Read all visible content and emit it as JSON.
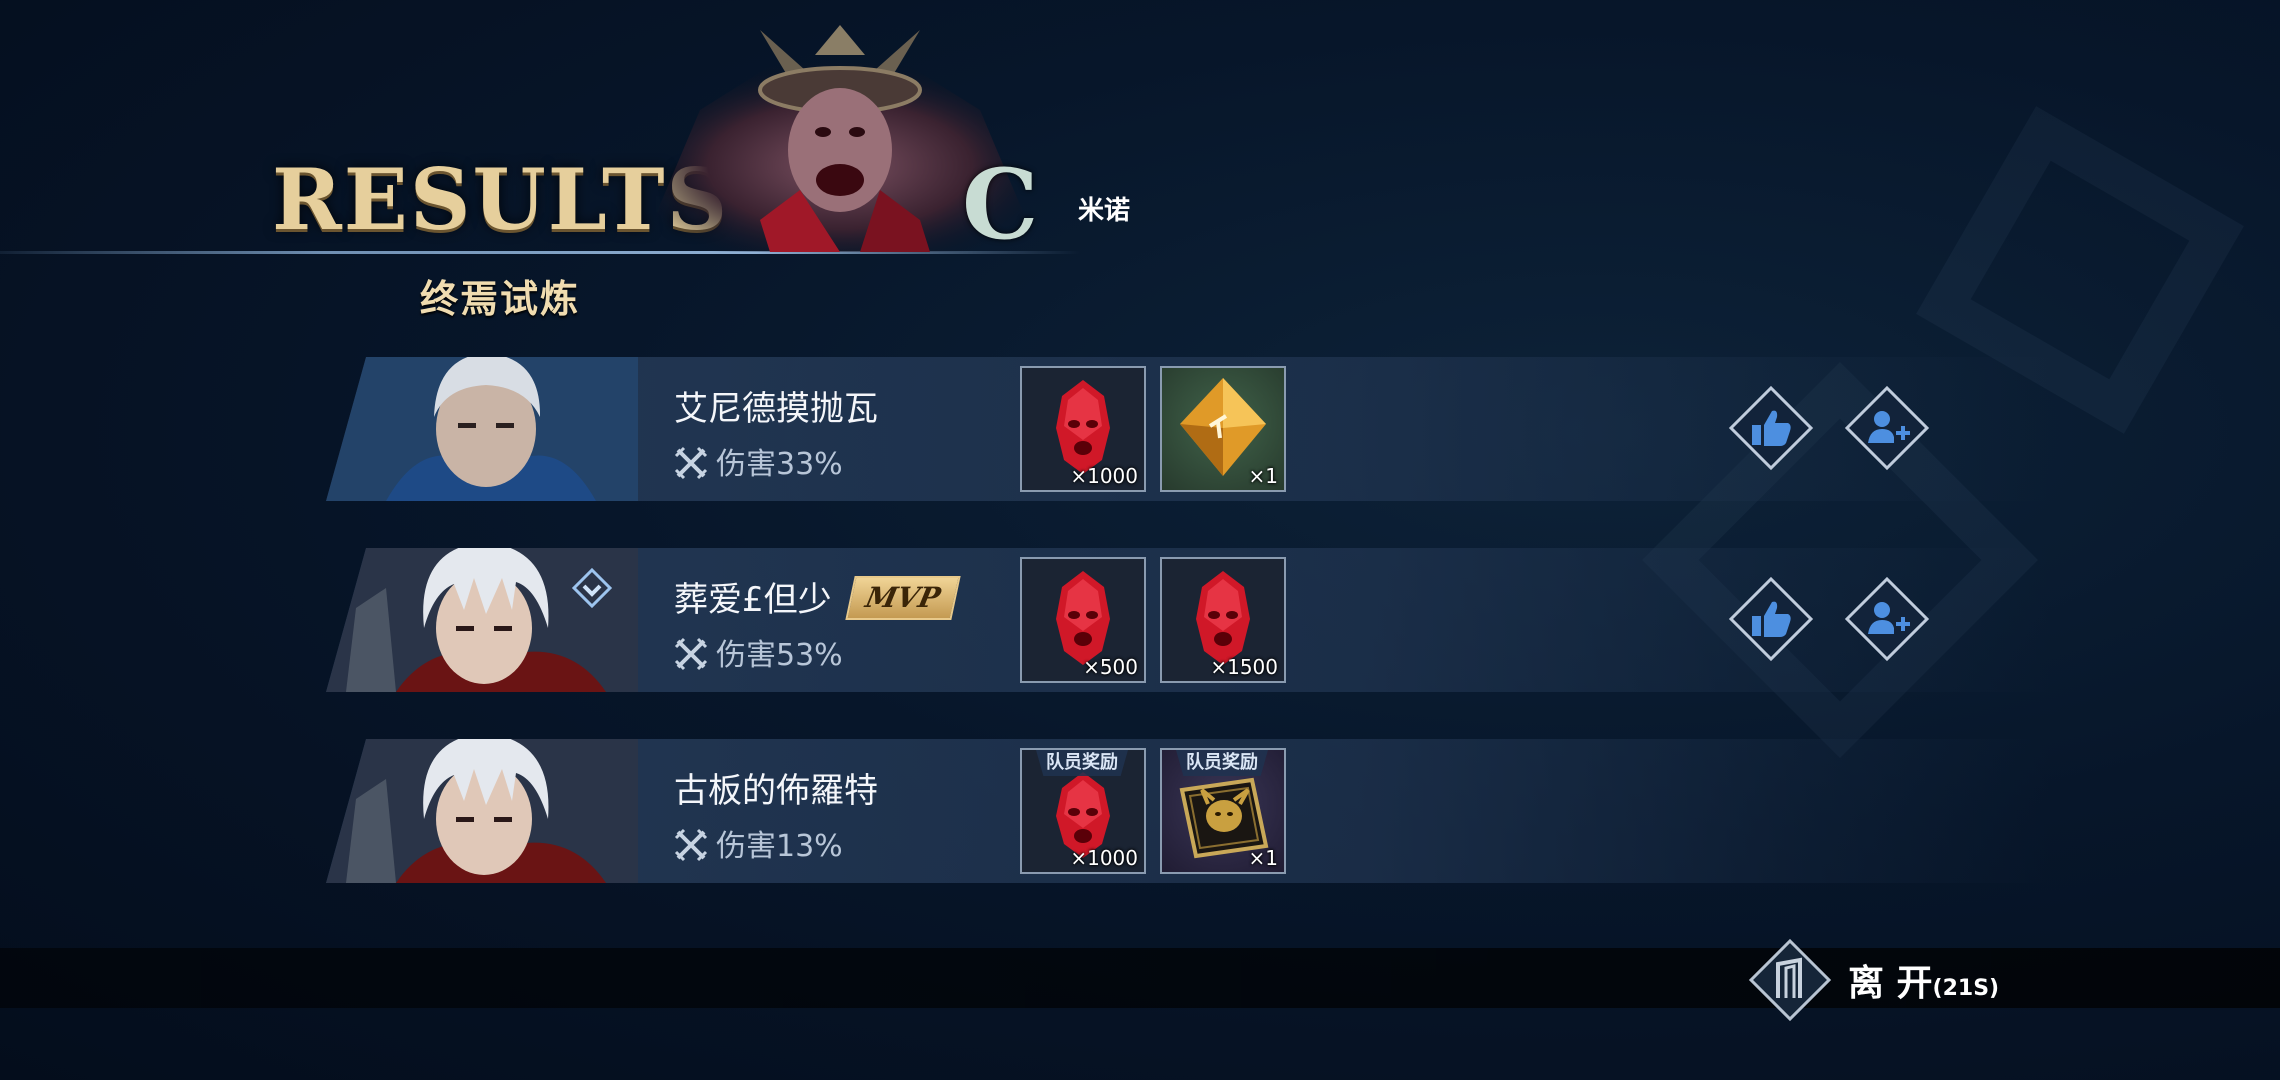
{
  "header": {
    "title": "RESULTS",
    "subtitle": "终焉试炼",
    "grade": "C",
    "boss_name": "米诺"
  },
  "players": [
    {
      "name": "艾尼德摸抛瓦",
      "damage_label": "伤害",
      "damage_pct": "33%",
      "mvp": false,
      "rewards": [
        {
          "icon": "red-orb-icon",
          "qty": "×1000",
          "tag": ""
        },
        {
          "icon": "gold-crystal-icon",
          "qty": "×1",
          "tag": ""
        }
      ],
      "actions": [
        "like-icon",
        "add-friend-icon"
      ]
    },
    {
      "name": "葬爱£但少",
      "damage_label": "伤害",
      "damage_pct": "53%",
      "mvp": true,
      "mvp_label": "MVP",
      "rewards": [
        {
          "icon": "red-orb-icon",
          "qty": "×500",
          "tag": ""
        },
        {
          "icon": "red-orb-icon",
          "qty": "×1500",
          "tag": ""
        }
      ],
      "actions": [
        "like-icon",
        "add-friend-icon"
      ]
    },
    {
      "name": "古板的佈羅特",
      "damage_label": "伤害",
      "damage_pct": "13%",
      "mvp": false,
      "rewards": [
        {
          "icon": "red-orb-icon",
          "qty": "×1000",
          "tag": "队员奖励"
        },
        {
          "icon": "demon-book-icon",
          "qty": "×1",
          "tag": "队员奖励"
        }
      ],
      "actions": []
    }
  ],
  "footer": {
    "leave_label": "离 开",
    "countdown": "(21S)"
  },
  "colors": {
    "title_gold": "#e6cf9c",
    "grade_color": "#c8dcd3",
    "mvp_gold": "#d9b46a",
    "action_blue": "#4d8fe0"
  }
}
